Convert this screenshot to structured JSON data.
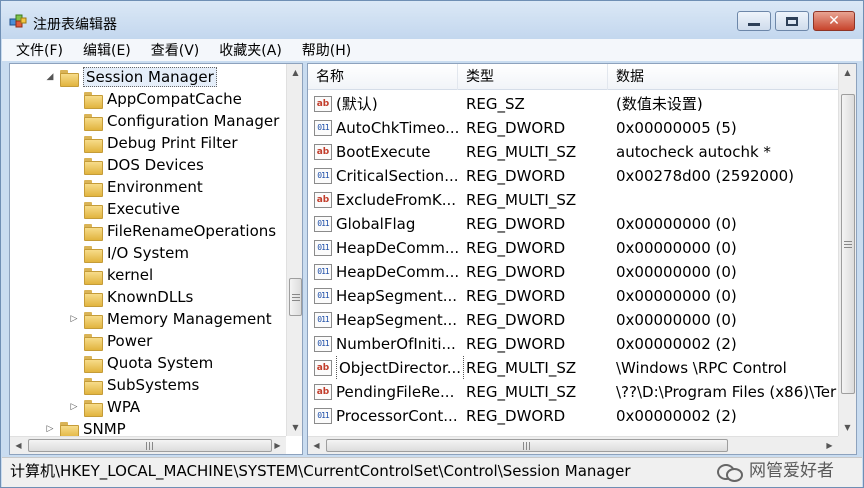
{
  "window": {
    "title": "注册表编辑器"
  },
  "menu": [
    "文件(F)",
    "编辑(E)",
    "查看(V)",
    "收藏夹(A)",
    "帮助(H)"
  ],
  "tree": {
    "selected": "Session Manager",
    "items": [
      {
        "label": "Session Manager",
        "expander": "◢",
        "level": 0,
        "selected": true
      },
      {
        "label": "AppCompatCache",
        "expander": "",
        "level": 1
      },
      {
        "label": "Configuration Manager",
        "expander": "",
        "level": 1
      },
      {
        "label": "Debug Print Filter",
        "expander": "",
        "level": 1
      },
      {
        "label": "DOS Devices",
        "expander": "",
        "level": 1
      },
      {
        "label": "Environment",
        "expander": "",
        "level": 1
      },
      {
        "label": "Executive",
        "expander": "",
        "level": 1
      },
      {
        "label": "FileRenameOperations",
        "expander": "",
        "level": 1
      },
      {
        "label": "I/O System",
        "expander": "",
        "level": 1
      },
      {
        "label": "kernel",
        "expander": "",
        "level": 1
      },
      {
        "label": "KnownDLLs",
        "expander": "",
        "level": 1
      },
      {
        "label": "Memory Management",
        "expander": "▷",
        "level": 1
      },
      {
        "label": "Power",
        "expander": "",
        "level": 1
      },
      {
        "label": "Quota System",
        "expander": "",
        "level": 1
      },
      {
        "label": "SubSystems",
        "expander": "",
        "level": 1
      },
      {
        "label": "WPA",
        "expander": "▷",
        "level": 1
      },
      {
        "label": "SNMP",
        "expander": "▷",
        "level": 0
      }
    ]
  },
  "list": {
    "columns": [
      "名称",
      "类型",
      "数据"
    ],
    "rows": [
      {
        "icon": "ab",
        "name": "(默认)",
        "type": "REG_SZ",
        "data": "(数值未设置)"
      },
      {
        "icon": "bin",
        "name": "AutoChkTimeo...",
        "type": "REG_DWORD",
        "data": "0x00000005 (5)"
      },
      {
        "icon": "ab",
        "name": "BootExecute",
        "type": "REG_MULTI_SZ",
        "data": "autocheck autochk *"
      },
      {
        "icon": "bin",
        "name": "CriticalSection...",
        "type": "REG_DWORD",
        "data": "0x00278d00 (2592000)"
      },
      {
        "icon": "ab",
        "name": "ExcludeFromK...",
        "type": "REG_MULTI_SZ",
        "data": ""
      },
      {
        "icon": "bin",
        "name": "GlobalFlag",
        "type": "REG_DWORD",
        "data": "0x00000000 (0)"
      },
      {
        "icon": "bin",
        "name": "HeapDeComm...",
        "type": "REG_DWORD",
        "data": "0x00000000 (0)"
      },
      {
        "icon": "bin",
        "name": "HeapDeComm...",
        "type": "REG_DWORD",
        "data": "0x00000000 (0)"
      },
      {
        "icon": "bin",
        "name": "HeapSegment...",
        "type": "REG_DWORD",
        "data": "0x00000000 (0)"
      },
      {
        "icon": "bin",
        "name": "HeapSegment...",
        "type": "REG_DWORD",
        "data": "0x00000000 (0)"
      },
      {
        "icon": "bin",
        "name": "NumberOfIniti...",
        "type": "REG_DWORD",
        "data": "0x00000002 (2)"
      },
      {
        "icon": "ab",
        "name": "ObjectDirector...",
        "type": "REG_MULTI_SZ",
        "data": "\\Windows \\RPC Control",
        "focused": true
      },
      {
        "icon": "ab",
        "name": "PendingFileRe...",
        "type": "REG_MULTI_SZ",
        "data": "\\??\\D:\\Program Files (x86)\\Ter"
      },
      {
        "icon": "bin",
        "name": "ProcessorCont...",
        "type": "REG_DWORD",
        "data": "0x00000002 (2)"
      }
    ]
  },
  "icons": {
    "ab": "string-value-icon",
    "bin": "binary-value-icon"
  },
  "status": {
    "path": "计算机\\HKEY_LOCAL_MACHINE\\SYSTEM\\CurrentControlSet\\Control\\Session Manager"
  },
  "watermark": {
    "text": "网管爱好者"
  }
}
